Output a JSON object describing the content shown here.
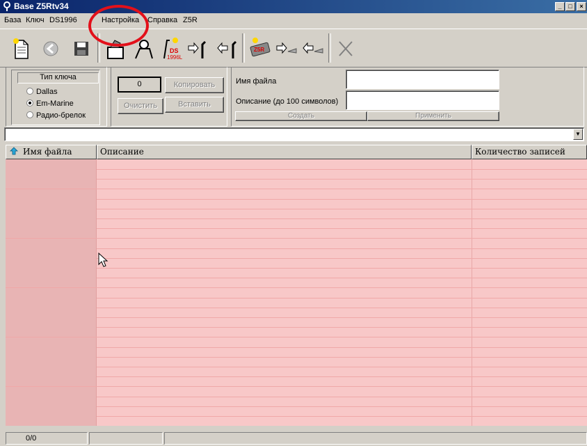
{
  "window": {
    "title": "Base Z5Rtv34",
    "controls": [
      "_",
      "□",
      "×"
    ]
  },
  "menu": [
    "База",
    "Ключ",
    "DS1996",
    "Настройка",
    "Справка",
    "Z5R"
  ],
  "toolbar": {
    "icons": [
      "new-document-icon",
      "back-icon",
      "save-icon",
      "key-read-icon",
      "key-write-icon",
      "ds1996-icon",
      "arrow-right-key-icon",
      "arrow-left-key-icon",
      "z5r-controller-icon",
      "arrow-right-device-icon",
      "arrow-left-device-icon",
      "close-x-icon"
    ],
    "ds_label": "DS",
    "ds_sub": "1996L",
    "z5r_label": "Z5R"
  },
  "key_type": {
    "title": "Тип ключа",
    "options": [
      {
        "label": "Dallas",
        "selected": false
      },
      {
        "label": "Em-Marine",
        "selected": true
      },
      {
        "label": "Радио-брелок",
        "selected": false
      }
    ]
  },
  "counter": {
    "value": "0"
  },
  "buttons": {
    "copy": "Копировать",
    "clear": "Очистить",
    "paste": "Вставить",
    "create": "Создать",
    "apply": "Применить"
  },
  "file_form": {
    "filename_label": "Имя файла",
    "description_label": "Описание (до 100 символов)",
    "filename_value": "",
    "description_value": ""
  },
  "table": {
    "columns": [
      "Имя файла",
      "Описание",
      "Количество записей"
    ],
    "row_count": 27
  },
  "status": {
    "position": "0/0",
    "panel2": "",
    "panel3": ""
  },
  "colors": {
    "title_bar": "#0a246a",
    "grid_bg": "#f8c8c8",
    "first_col": "#e8b4b4",
    "annotation": "#e3101a"
  }
}
